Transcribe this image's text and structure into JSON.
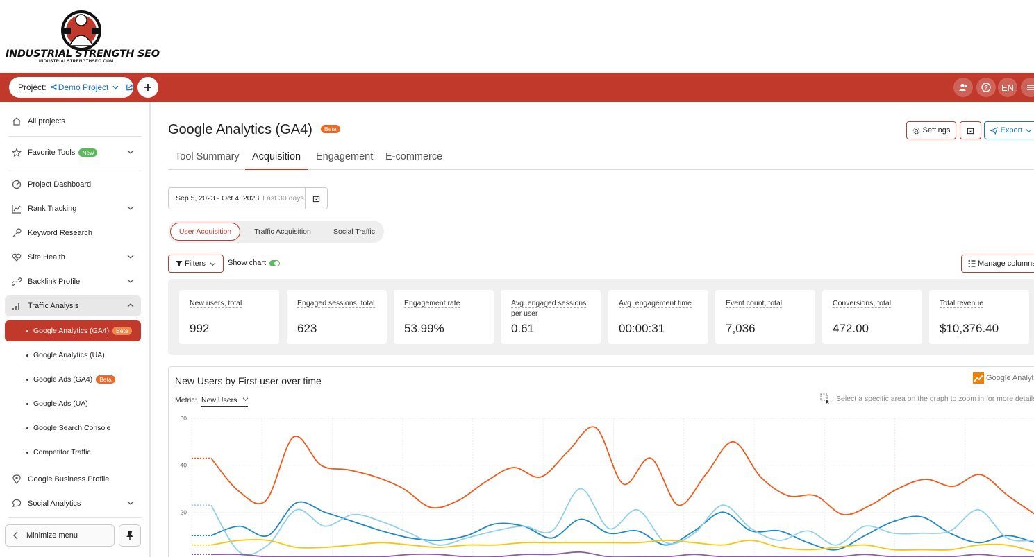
{
  "brand": {
    "name": "INDUSTRIAL STRENGTH SEO",
    "url": "INDUSTRIALSTRENGTHSEO.COM"
  },
  "topbar": {
    "project_label": "Project:",
    "project_name": "Demo Project",
    "lang": "EN",
    "color": "#c0392b"
  },
  "sidebar": {
    "all_projects": "All projects",
    "favorite_tools": "Favorite Tools",
    "new_badge": "New",
    "project_dashboard": "Project Dashboard",
    "rank_tracking": "Rank Tracking",
    "keyword_research": "Keyword Research",
    "site_health": "Site Health",
    "backlink_profile": "Backlink Profile",
    "traffic_analysis": "Traffic Analysis",
    "sub": [
      {
        "label": "Google Analytics (GA4)",
        "badge": "Beta"
      },
      {
        "label": "Google Analytics (UA)",
        "badge": ""
      },
      {
        "label": "Google Ads (GA4)",
        "badge": "Beta"
      },
      {
        "label": "Google Ads (UA)",
        "badge": ""
      },
      {
        "label": "Google Search Console",
        "badge": ""
      },
      {
        "label": "Competitor Traffic",
        "badge": ""
      }
    ],
    "google_business_profile": "Google Business Profile",
    "social_analytics": "Social Analytics",
    "minimize": "Minimize menu"
  },
  "header": {
    "title": "Google Analytics (GA4)",
    "badge": "Beta",
    "settings": "Settings",
    "export": "Export"
  },
  "tabs": [
    "Tool Summary",
    "Acquisition",
    "Engagement",
    "E-commerce"
  ],
  "date": {
    "range": "Sep 5, 2023 - Oct 4, 2023",
    "hint": "Last 30 days"
  },
  "segments": [
    "User Acquisition",
    "Traffic Acquisition",
    "Social Traffic"
  ],
  "controls": {
    "filters": "Filters",
    "show_chart": "Show chart",
    "manage_columns": "Manage columns"
  },
  "kpis": [
    {
      "label": "New users, total",
      "value": "992"
    },
    {
      "label": "Engaged sessions, total",
      "value": "623"
    },
    {
      "label": "Engagement rate",
      "value": "53.99%"
    },
    {
      "label": "Avg. engaged sessions per user",
      "value": "0.61"
    },
    {
      "label": "Avg. engagement time",
      "value": "00:00:31"
    },
    {
      "label": "Event count, total",
      "value": "7,036"
    },
    {
      "label": "Conversions, total",
      "value": "472.00"
    },
    {
      "label": "Total revenue",
      "value": "$10,376.40"
    }
  ],
  "chart": {
    "title": "New Users by First user over time",
    "metric_label": "Metric:",
    "metric_value": "New Users",
    "ga_brand": "Google Analytics",
    "zoom_hint": "Select a specific area on the graph to zoom in for more details"
  },
  "chart_data": {
    "type": "line",
    "y_ticks": [
      "60",
      "40",
      "20"
    ],
    "ylim": [
      0,
      60
    ],
    "grid": true,
    "series": [
      {
        "color": "#f05a1a",
        "values": [
          43,
          29,
          25,
          52,
          40,
          38,
          35,
          30,
          22,
          25,
          33,
          39,
          35,
          46,
          56,
          32,
          43,
          23,
          36,
          50,
          35,
          27,
          27,
          19,
          23,
          30,
          34,
          31,
          36,
          27,
          19
        ]
      },
      {
        "color": "#1e88c8",
        "values": [
          10,
          14,
          10,
          24,
          20,
          16,
          12,
          9,
          8,
          10,
          15,
          14,
          9,
          17,
          11,
          12,
          6,
          12,
          20,
          12,
          12,
          7,
          4,
          10,
          16,
          18,
          11,
          7,
          10,
          7
        ]
      },
      {
        "color": "#90d0ec",
        "values": [
          23,
          3,
          6,
          21,
          14,
          19,
          16,
          11,
          6,
          9,
          12,
          14,
          12,
          30,
          13,
          21,
          7,
          11,
          23,
          13,
          8,
          12,
          6,
          14,
          11,
          11,
          12,
          21,
          9,
          8
        ]
      },
      {
        "color": "#f5c518",
        "values": [
          6,
          8,
          8,
          5,
          5,
          6,
          7,
          6,
          5,
          6,
          6,
          7,
          7,
          7,
          7,
          7,
          8,
          7,
          6,
          8,
          5,
          4,
          5,
          6,
          4,
          4,
          4,
          6,
          6,
          3
        ]
      },
      {
        "color": "#8e5ba8",
        "values": [
          2,
          2,
          1,
          1,
          1,
          1,
          1,
          2,
          2,
          1,
          1,
          2,
          2,
          3,
          1,
          1,
          1,
          2,
          1,
          1,
          1,
          1,
          1,
          2,
          1,
          1,
          1,
          2,
          1,
          1
        ]
      }
    ]
  }
}
